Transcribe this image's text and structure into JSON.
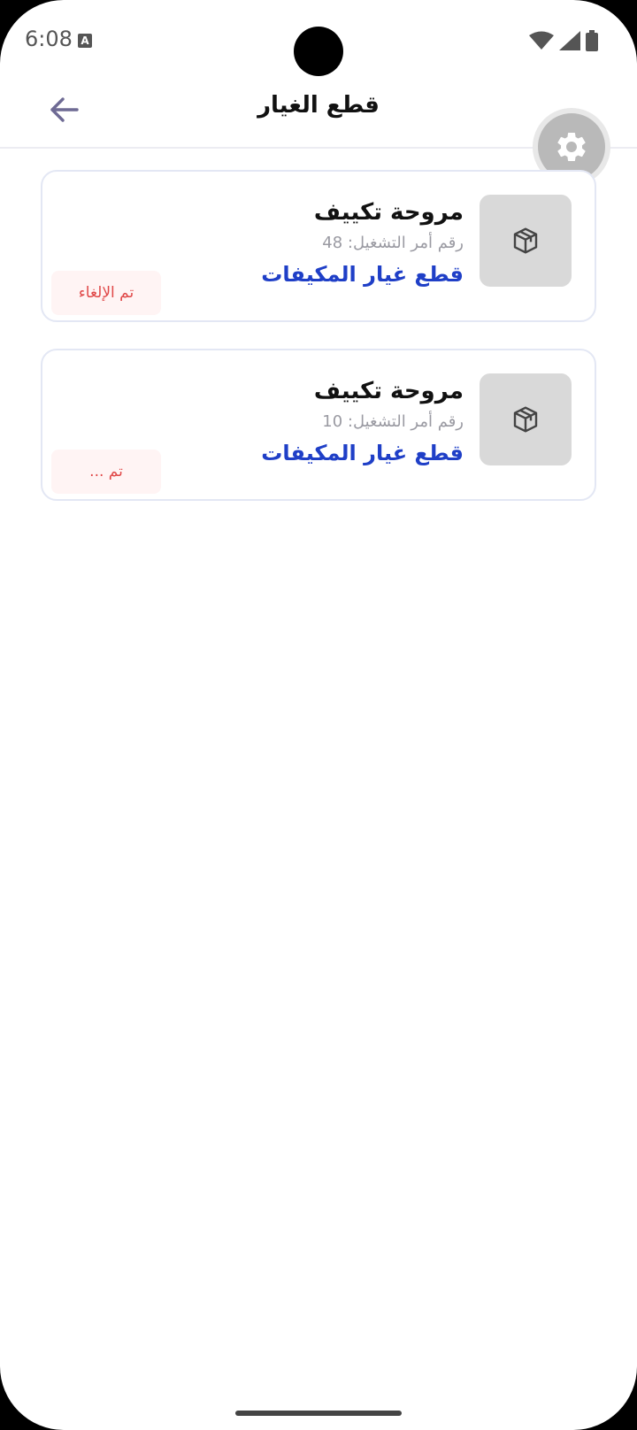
{
  "status_bar": {
    "time": "6:08"
  },
  "header": {
    "title": "قطع الغيار"
  },
  "items": [
    {
      "name": "مروحة تكييف",
      "order_label": "رقم أمر التشغيل: 48",
      "category": "قطع غيار المكيفات",
      "status": "تم الإلغاء"
    },
    {
      "name": "مروحة تكييف",
      "order_label": "رقم أمر التشغيل: 10",
      "category": "قطع غيار المكيفات",
      "status": "تم ..."
    }
  ],
  "colors": {
    "accent": "#1f3fc7",
    "status_cancelled": "#e04848",
    "back_arrow": "#6e6a94"
  },
  "icons": {
    "back": "arrow-left-icon",
    "settings": "gear-icon",
    "item": "box-icon",
    "wifi": "wifi-icon",
    "signal": "signal-icon",
    "battery": "battery-icon"
  }
}
